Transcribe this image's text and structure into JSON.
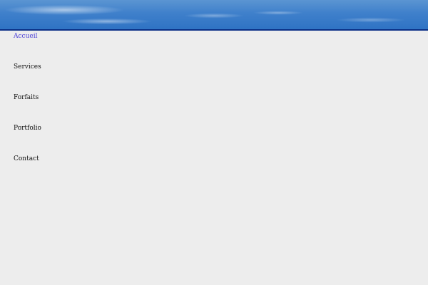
{
  "nav": {
    "items": [
      {
        "label": "Accueil",
        "active": true
      },
      {
        "label": "Services",
        "active": false
      },
      {
        "label": "Forfaits",
        "active": false
      },
      {
        "label": "Portfolio",
        "active": false
      },
      {
        "label": "Contact",
        "active": false
      }
    ]
  },
  "colors": {
    "page_background": "#ededed",
    "banner_sky": "#3f80cb",
    "banner_rule": "#0a2f86",
    "active_link": "#4a3fd6",
    "link": "#111111"
  }
}
